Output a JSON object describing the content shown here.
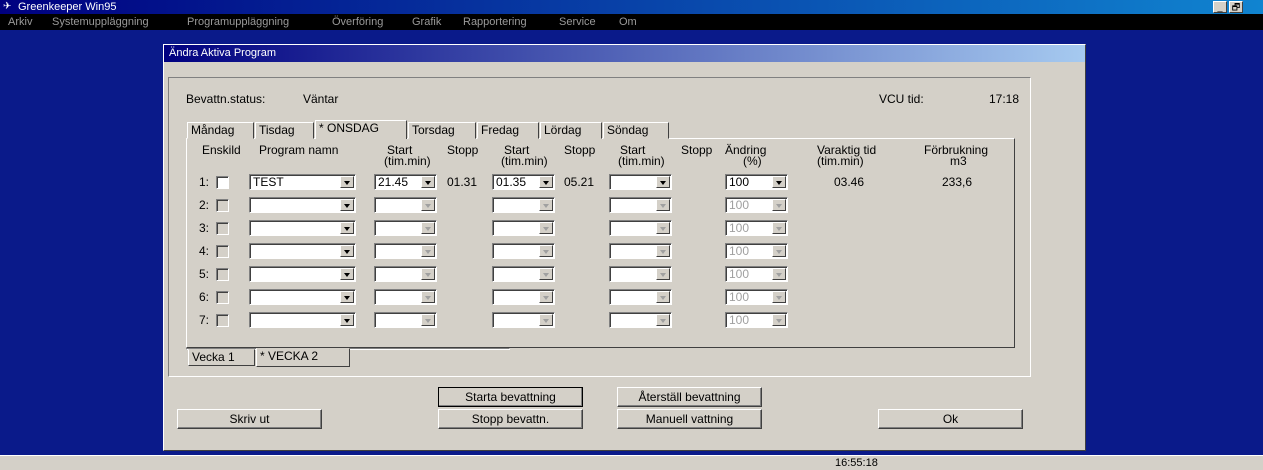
{
  "app": {
    "title": "Greenkeeper Win95",
    "menu": [
      "Arkiv",
      "Systemuppläggning",
      "Programuppläggning",
      "Överföring",
      "Grafik",
      "Rapportering",
      "Service",
      "Om"
    ],
    "window_buttons": {
      "minimize": "_",
      "restore": "🗗"
    }
  },
  "dialog": {
    "title": "Ändra Aktiva Program",
    "status_label": "Bevattn.status:",
    "status_value": "Väntar",
    "vcu_label": "VCU tid:",
    "vcu_value": "17:18",
    "day_tabs": [
      "Måndag",
      "Tisdag",
      "* ONSDAG",
      "Torsdag",
      "Fredag",
      "Lördag",
      "Söndag"
    ],
    "active_day_tab": "* ONSDAG",
    "week_tabs": [
      "Vecka 1",
      "* VECKA 2"
    ],
    "active_week_tab": "* VECKA 2",
    "headers": {
      "enskild": "Enskild",
      "program": "Program namn",
      "start1": "Start",
      "start1_unit": "(tim.min)",
      "stopp1": "Stopp",
      "start2": "Start",
      "start2_unit": "(tim.min)",
      "stopp2": "Stopp",
      "start3": "Start",
      "start3_unit": "(tim.min)",
      "stopp3": "Stopp",
      "andring": "Ändring",
      "andring_unit": "(%)",
      "varaktig": "Varaktig tid",
      "varaktig_unit": "(tim.min)",
      "forbrukning": "Förbrukning",
      "forbrukning_unit": "m3"
    },
    "rows": [
      {
        "no": "1:",
        "program": "TEST",
        "start1": "21.45",
        "stopp1": "01.31",
        "start2": "01.35",
        "stopp2": "05.21",
        "start3": "",
        "andring": "100",
        "varaktig": "03.46",
        "forbrukning": "233,6"
      },
      {
        "no": "2:",
        "program": "",
        "start1": "",
        "stopp1": "",
        "start2": "",
        "stopp2": "",
        "start3": "",
        "andring": "100",
        "varaktig": "",
        "forbrukning": ""
      },
      {
        "no": "3:",
        "program": "",
        "start1": "",
        "stopp1": "",
        "start2": "",
        "stopp2": "",
        "start3": "",
        "andring": "100",
        "varaktig": "",
        "forbrukning": ""
      },
      {
        "no": "4:",
        "program": "",
        "start1": "",
        "stopp1": "",
        "start2": "",
        "stopp2": "",
        "start3": "",
        "andring": "100",
        "varaktig": "",
        "forbrukning": ""
      },
      {
        "no": "5:",
        "program": "",
        "start1": "",
        "stopp1": "",
        "start2": "",
        "stopp2": "",
        "start3": "",
        "andring": "100",
        "varaktig": "",
        "forbrukning": ""
      },
      {
        "no": "6:",
        "program": "",
        "start1": "",
        "stopp1": "",
        "start2": "",
        "stopp2": "",
        "start3": "",
        "andring": "100",
        "varaktig": "",
        "forbrukning": ""
      },
      {
        "no": "7:",
        "program": "",
        "start1": "",
        "stopp1": "",
        "start2": "",
        "stopp2": "",
        "start3": "",
        "andring": "100",
        "varaktig": "",
        "forbrukning": ""
      }
    ],
    "buttons": {
      "starta": "Starta bevattning",
      "aterstall": "Återställ bevattning",
      "skriv": "Skriv ut",
      "stopp": "Stopp bevattn.",
      "manuell": "Manuell vattning",
      "ok": "Ok"
    }
  },
  "statusbar": {
    "time": "16:55:18"
  },
  "colors": {
    "desktop": "#0a1a8a",
    "titlebar": "#000080",
    "face": "#d4d0c8"
  }
}
